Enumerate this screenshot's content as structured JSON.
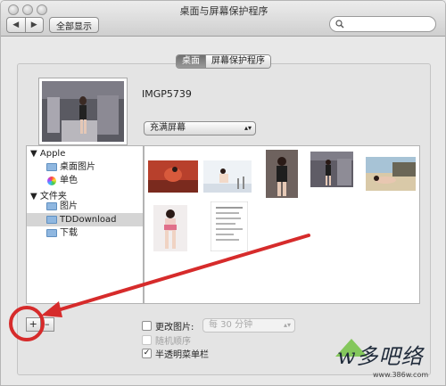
{
  "window": {
    "title": "桌面与屏幕保护程序"
  },
  "toolbar": {
    "back_icon": "chevron-left-icon",
    "forward_icon": "chevron-right-icon",
    "back_glyph": "◀",
    "forward_glyph": "▶",
    "show_all_label": "全部显示",
    "search_placeholder": ""
  },
  "tabs": [
    {
      "label": "桌面",
      "active": true
    },
    {
      "label": "屏幕保护程序",
      "active": false
    }
  ],
  "preview": {
    "file_name": "IMGP5739"
  },
  "fill_mode": {
    "selected": "充满屏幕"
  },
  "sources": {
    "groups": [
      {
        "label": "Apple",
        "items": [
          {
            "label": "桌面图片",
            "icon": "folder-icon"
          },
          {
            "label": "单色",
            "icon": "color-icon"
          }
        ]
      },
      {
        "label": "文件夹",
        "items": [
          {
            "label": "图片",
            "icon": "folder-icon"
          },
          {
            "label": "TDDownload",
            "icon": "folder-icon",
            "selected": true
          },
          {
            "label": "下载",
            "icon": "folder-icon"
          }
        ]
      }
    ],
    "disclosure_glyph": "▼"
  },
  "controls": {
    "add_label": "+",
    "remove_label": "–",
    "change_picture_label": "更改图片:",
    "interval_value": "每 30 分钟",
    "random_order_label": "随机顺序",
    "translucent_menu_label": "半透明菜单栏",
    "translucent_checked": true,
    "check_glyph": "✓"
  },
  "watermark": {
    "text": "w多吧络",
    "url": "www.386w.com"
  },
  "colors": {
    "annotation": "#d62b2b",
    "selected_tab": "#7a7a7a"
  }
}
